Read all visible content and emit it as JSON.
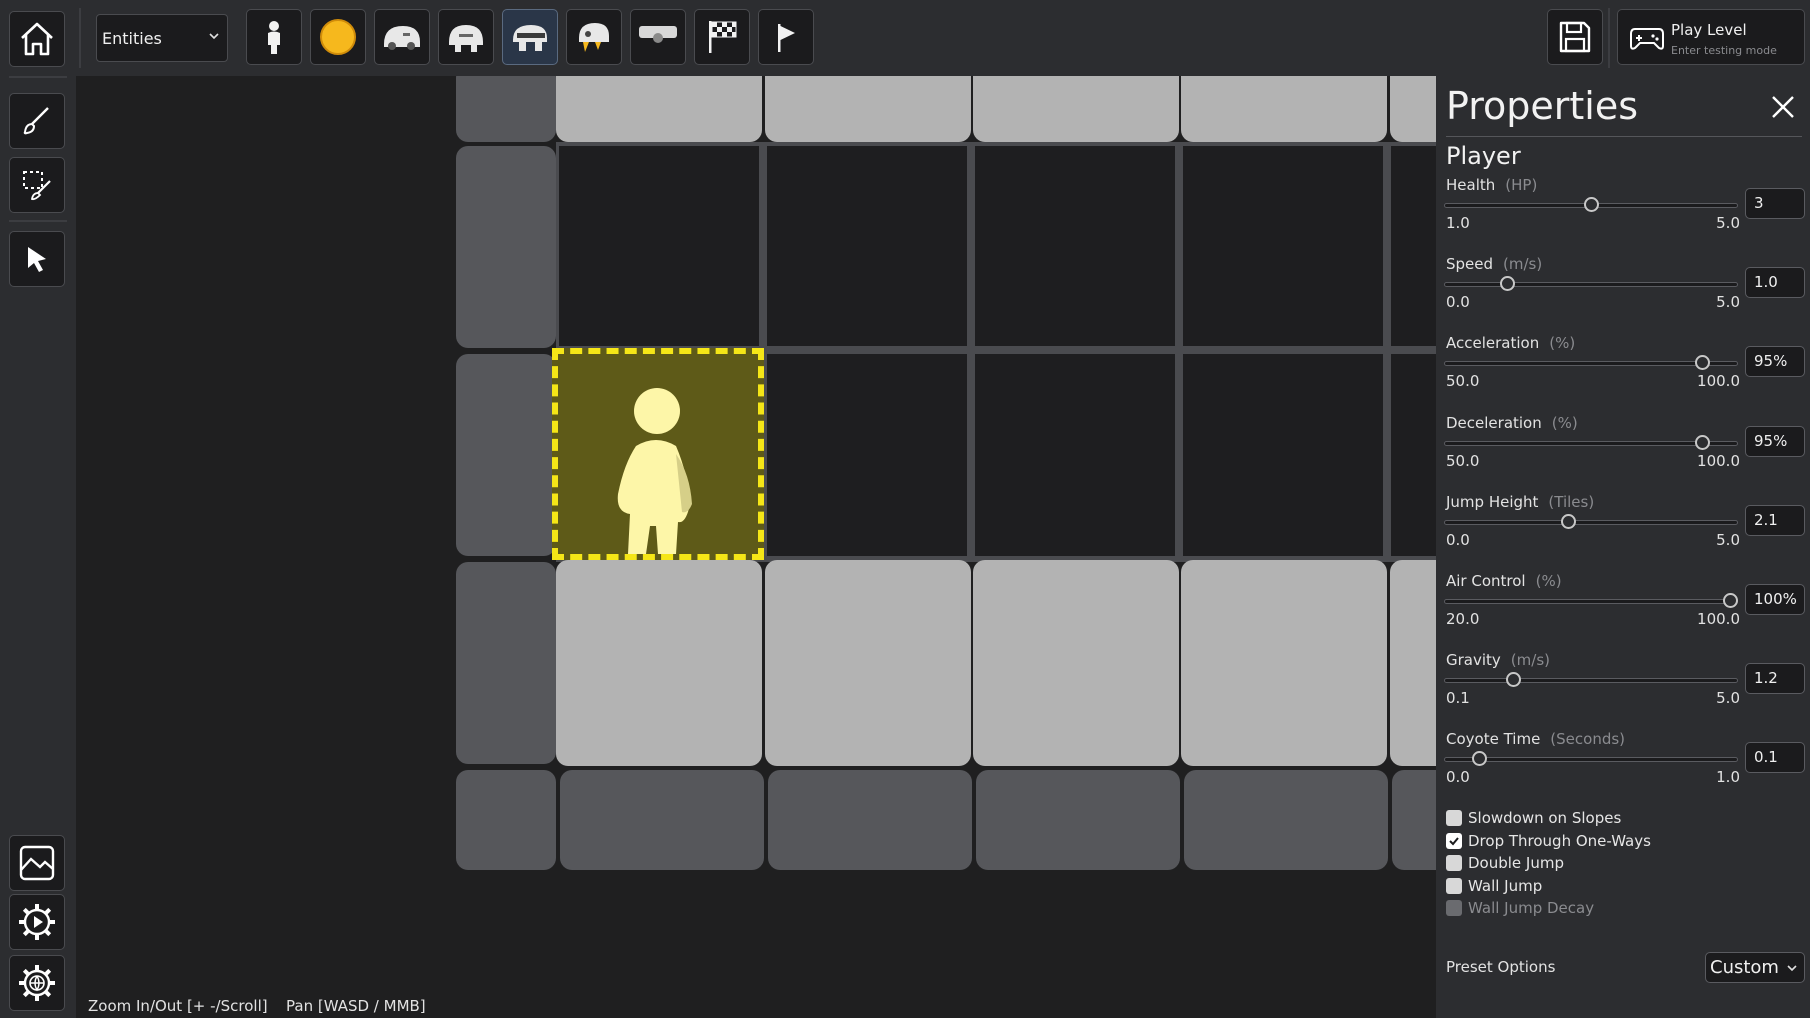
{
  "toolbar": {
    "entity_dropdown": {
      "selected": "Entities"
    },
    "palette": [
      {
        "name": "player-entity-icon"
      },
      {
        "name": "coin-entity-icon"
      },
      {
        "name": "slime-enemy-icon"
      },
      {
        "name": "walker-enemy-icon"
      },
      {
        "name": "charger-enemy-icon"
      },
      {
        "name": "flyer-enemy-icon"
      },
      {
        "name": "moving-platform-icon"
      },
      {
        "name": "finish-flag-icon"
      },
      {
        "name": "checkpoint-flag-icon"
      }
    ],
    "active_palette_index": 4,
    "play_level": {
      "title": "Play Level",
      "subtitle": "Enter testing mode"
    }
  },
  "status_bar": {
    "zoom_hint": "Zoom In/Out [+ -/Scroll]",
    "pan_hint": "Pan [WASD / MMB]"
  },
  "properties": {
    "title": "Properties",
    "entity_name": "Player",
    "fields": [
      {
        "label": "Health",
        "unit": "(HP)",
        "min": "1.0",
        "max": "5.0",
        "value": "3",
        "fraction": 0.5
      },
      {
        "label": "Speed",
        "unit": "(m/s)",
        "min": "0.0",
        "max": "5.0",
        "value": "1.0",
        "fraction": 0.2
      },
      {
        "label": "Acceleration",
        "unit": "(%)",
        "min": "50.0",
        "max": "100.0",
        "value": "95%",
        "fraction": 0.9
      },
      {
        "label": "Deceleration",
        "unit": "(%)",
        "min": "50.0",
        "max": "100.0",
        "value": "95%",
        "fraction": 0.9
      },
      {
        "label": "Jump Height",
        "unit": "(Tiles)",
        "min": "0.0",
        "max": "5.0",
        "value": "2.1",
        "fraction": 0.42
      },
      {
        "label": "Air Control",
        "unit": "(%)",
        "min": "20.0",
        "max": "100.0",
        "value": "100%",
        "fraction": 1.0
      },
      {
        "label": "Gravity",
        "unit": "(m/s)",
        "min": "0.1",
        "max": "5.0",
        "value": "1.2",
        "fraction": 0.224
      },
      {
        "label": "Coyote Time",
        "unit": "(Seconds)",
        "min": "0.0",
        "max": "1.0",
        "value": "0.1",
        "fraction": 0.1
      }
    ],
    "checkboxes": [
      {
        "label": "Slowdown on Slopes",
        "checked": false,
        "disabled": false
      },
      {
        "label": "Drop Through One-Ways",
        "checked": true,
        "disabled": false
      },
      {
        "label": "Double Jump",
        "checked": false,
        "disabled": false
      },
      {
        "label": "Wall Jump",
        "checked": false,
        "disabled": false
      },
      {
        "label": "Wall Jump Decay",
        "checked": false,
        "disabled": true
      }
    ],
    "preset": {
      "label": "Preset Options",
      "selected": "Custom"
    }
  },
  "colors": {
    "selection_border": "#f5e617",
    "selection_fill": "#5e5a18",
    "player_sprite": "#fdf6a8",
    "tile_light": "#b3b3b3",
    "tile_dark": "#56575b"
  }
}
